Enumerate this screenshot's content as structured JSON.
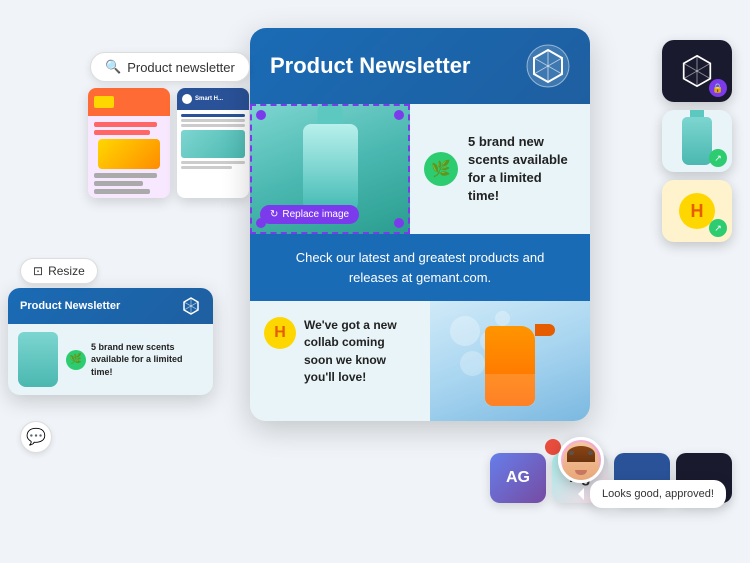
{
  "search": {
    "placeholder": "Product newsletter",
    "value": "Product newsletter"
  },
  "resize_btn": {
    "label": "Resize"
  },
  "main_card": {
    "title": "Product Newsletter",
    "section1_text": "5 brand new scents available for a limited time!",
    "section2_text": "Check our latest and greatest products and releases at gemant.com.",
    "section3_text": "We've got a new collab coming soon we know you'll love!",
    "replace_btn": "Replace image"
  },
  "mini_card": {
    "title": "Product Newsletter",
    "body_text": "5 brand new scents available for a limited time!"
  },
  "comment": {
    "text": "Looks good, approved!"
  },
  "bottom_icons": {
    "ag1": "AG",
    "ag2": "Ag"
  }
}
